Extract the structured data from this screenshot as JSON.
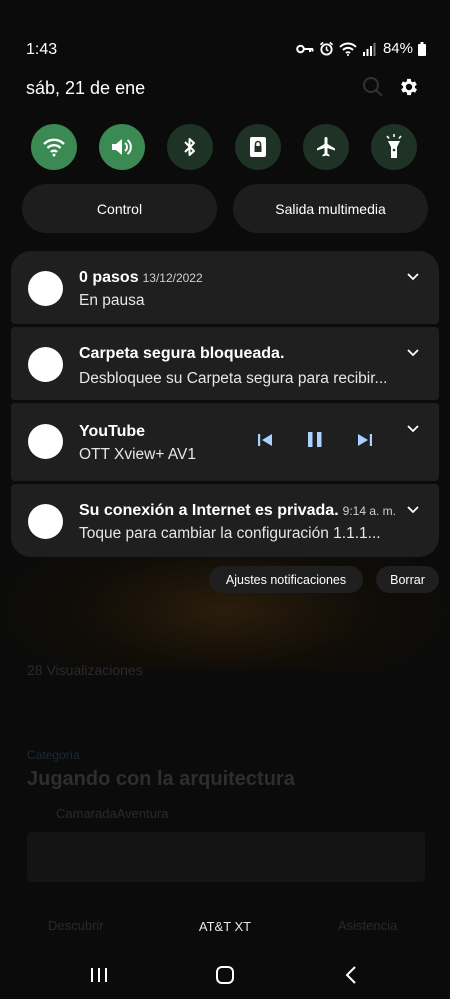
{
  "status_bar": {
    "time": "1:43",
    "battery_percent": "84%",
    "icons": [
      "key-icon",
      "alarm-icon",
      "wifi-icon",
      "signal-icon",
      "battery-icon"
    ]
  },
  "header": {
    "date": "sáb, 21 de ene",
    "actions": [
      "search-icon",
      "settings-icon"
    ]
  },
  "quick_toggles": [
    {
      "icon": "wifi-icon",
      "state": "on"
    },
    {
      "icon": "sound-icon",
      "state": "on"
    },
    {
      "icon": "bluetooth-icon",
      "state": "off"
    },
    {
      "icon": "rotation-lock-icon",
      "state": "off"
    },
    {
      "icon": "airplane-icon",
      "state": "off"
    },
    {
      "icon": "flashlight-icon",
      "state": "off"
    }
  ],
  "pills": {
    "control": "Control",
    "media_output": "Salida multimedia"
  },
  "notifications": [
    {
      "title": "0 pasos",
      "meta": "13/12/2022",
      "body": "En pausa"
    },
    {
      "title": "Carpeta segura bloqueada.",
      "meta": "",
      "body": "Desbloquee su Carpeta segura para recibir..."
    },
    {
      "title": "YouTube",
      "meta": "",
      "body": "OTT Xview+ AV1"
    },
    {
      "title": "Su conexión a Internet es privada.",
      "meta": "9:14 a. m.",
      "body": "Toque para cambiar la configuración 1.1.1..."
    }
  ],
  "notification_actions": {
    "settings": "Ajustes notificaciones",
    "clear": "Borrar"
  },
  "background": {
    "views": "28 Visualizaciones",
    "tag": "Categoría",
    "headline": "Jugando con la arquitectura",
    "author": "CamaradaAventura",
    "nav_discover": "Descubrir",
    "nav_assist": "Asistencia"
  },
  "carrier": "AT&T XT",
  "colors": {
    "toggle_on": "#3b8a54",
    "toggle_off": "#1e3226",
    "card_bg": "#1f1f1f",
    "media_control": "#a9d2ff"
  }
}
